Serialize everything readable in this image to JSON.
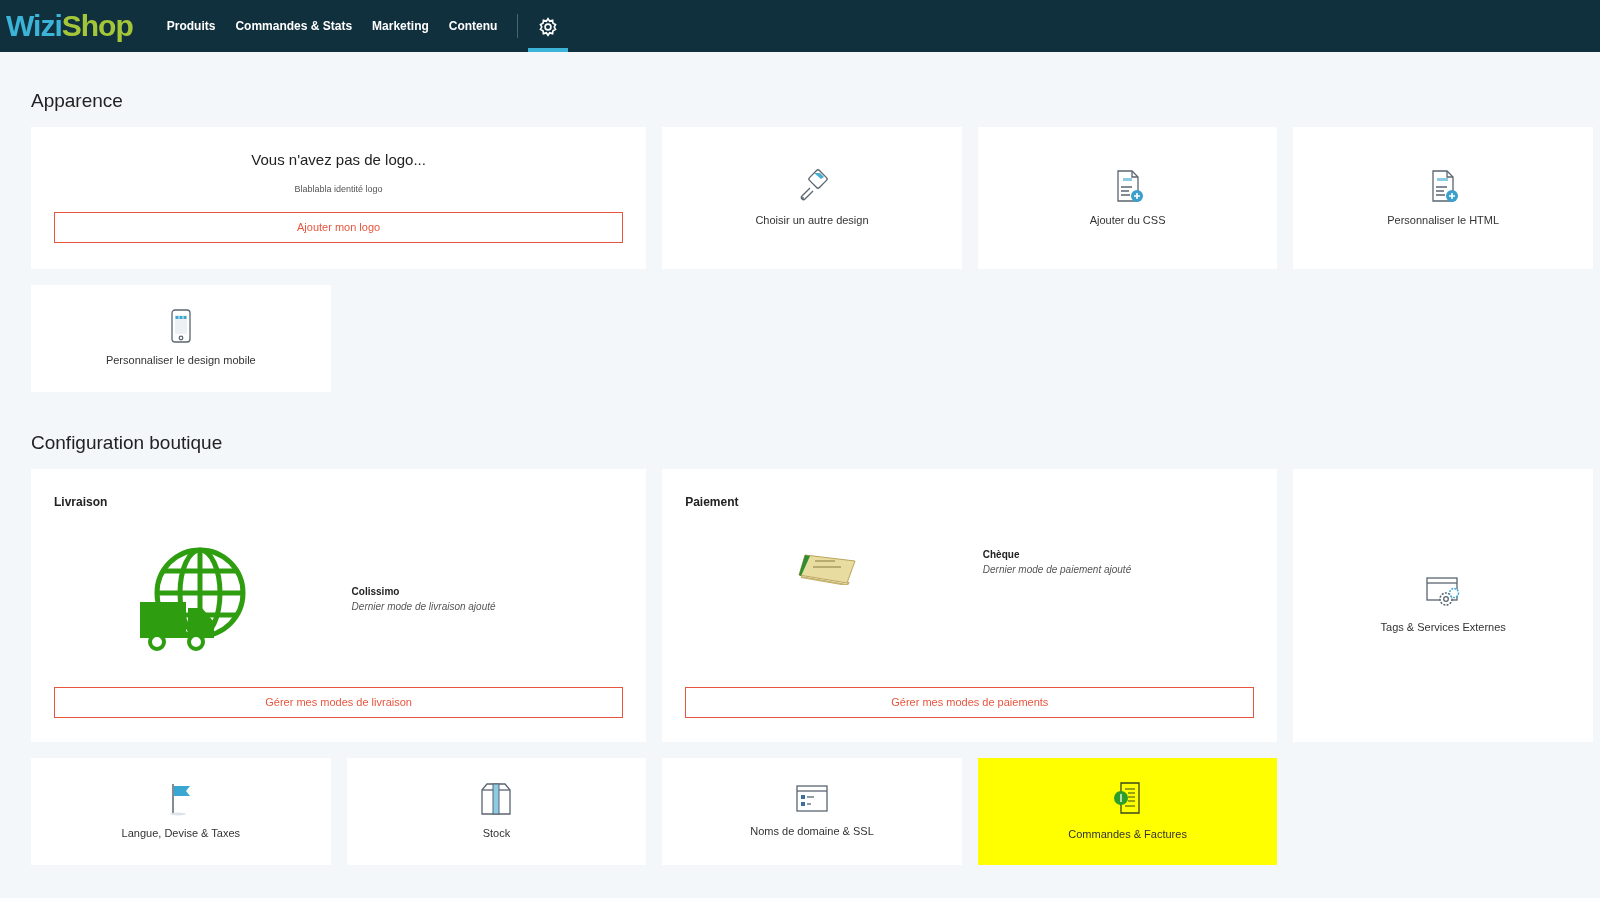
{
  "brand": {
    "part_1": "Wizi",
    "part_2": "Shop"
  },
  "nav": [
    {
      "label": "Produits",
      "selected": false
    },
    {
      "label": "Commandes & Stats",
      "selected": false
    },
    {
      "label": "Marketing",
      "selected": false
    },
    {
      "label": "Contenu",
      "selected": false
    }
  ],
  "settings": {
    "selected": true
  },
  "sections": [
    {
      "title": "Apparence",
      "tiles": [
        {
          "kind": "logo",
          "title": "Vous n'avez pas de logo...",
          "subtitle": "Blablabla identité logo",
          "button": "Ajouter mon logo"
        },
        {
          "kind": "link",
          "label": "Choisir un autre design",
          "highlighted": false
        },
        {
          "kind": "link",
          "label": "Ajouter du CSS",
          "highlighted": false
        },
        {
          "kind": "link",
          "label": "Personnaliser le HTML",
          "highlighted": false
        },
        {
          "kind": "link",
          "label": "Personnaliser le design mobile",
          "highlighted": false
        }
      ]
    },
    {
      "title": "Configuration boutique",
      "tiles": [
        {
          "kind": "shipping",
          "title": "Livraison",
          "method": "Colissimo",
          "note": "Dernier mode de livraison ajouté",
          "button": "Gérer mes modes de livraison"
        },
        {
          "kind": "payment",
          "title": "Paiement",
          "method": "Chèque",
          "note": "Dernier mode de paiement ajouté",
          "button": "Gérer mes modes de paiements"
        },
        {
          "kind": "link",
          "label": "Tags & Services Externes",
          "highlighted": false
        },
        {
          "kind": "link",
          "label": "Langue, Devise & Taxes",
          "highlighted": false
        },
        {
          "kind": "link",
          "label": "Stock",
          "highlighted": false
        },
        {
          "kind": "link",
          "label": "Noms de domaine & SSL",
          "highlighted": false
        },
        {
          "kind": "link",
          "label": "Commandes & Factures",
          "highlighted": true
        }
      ]
    }
  ]
}
